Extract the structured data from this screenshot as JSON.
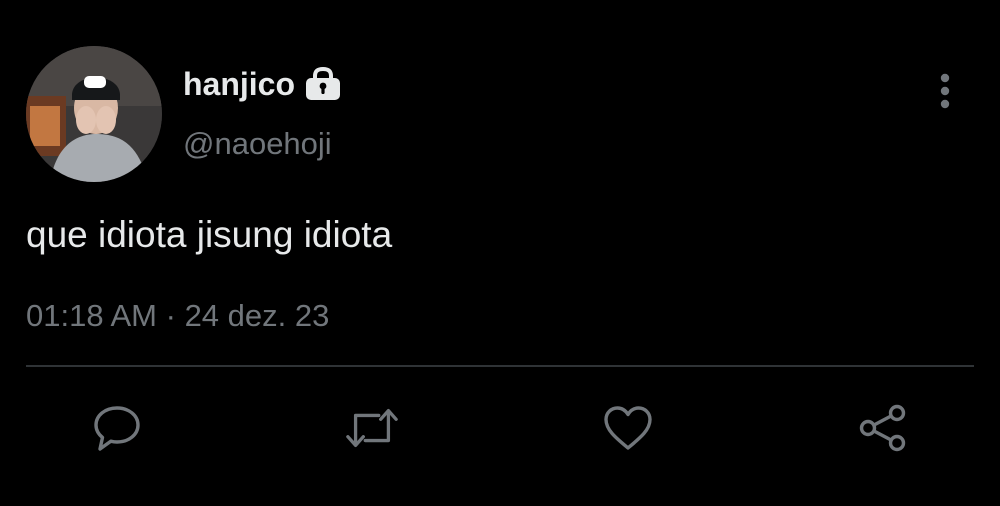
{
  "tweet": {
    "display_name": "hanjico",
    "handle": "@naoehoji",
    "text": "que idiota jisung idiota",
    "time": "01:18 AM",
    "separator": "·",
    "date": "24 dez. 23",
    "protected_icon": "lock-icon"
  },
  "actions": [
    {
      "name": "reply",
      "icon": "speech-bubble-icon"
    },
    {
      "name": "retweet",
      "icon": "retweet-icon"
    },
    {
      "name": "like",
      "icon": "heart-icon"
    },
    {
      "name": "share",
      "icon": "share-icon"
    }
  ],
  "colors": {
    "background": "#000000",
    "primary_text": "#e7e9ea",
    "secondary_text": "#71767b",
    "divider": "#2f3336",
    "icon": "#71767b"
  }
}
